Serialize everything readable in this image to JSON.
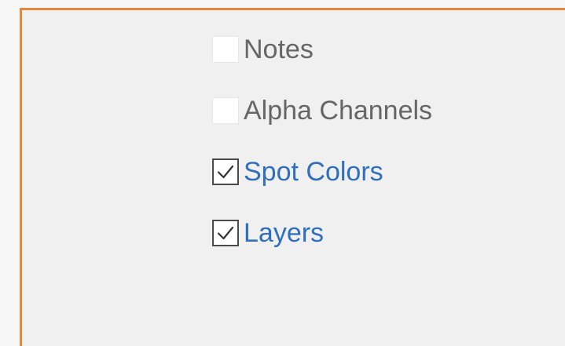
{
  "options": [
    {
      "label": "Notes",
      "checked": false,
      "enabled": false
    },
    {
      "label": "Alpha Channels",
      "checked": false,
      "enabled": false
    },
    {
      "label": "Spot Colors",
      "checked": true,
      "enabled": true
    },
    {
      "label": "Layers",
      "checked": true,
      "enabled": true
    }
  ],
  "colors": {
    "panel_border": "#e8873a",
    "panel_background": "#f0f0f0",
    "enabled_label": "#2f6fbe",
    "disabled_label": "#666666"
  }
}
